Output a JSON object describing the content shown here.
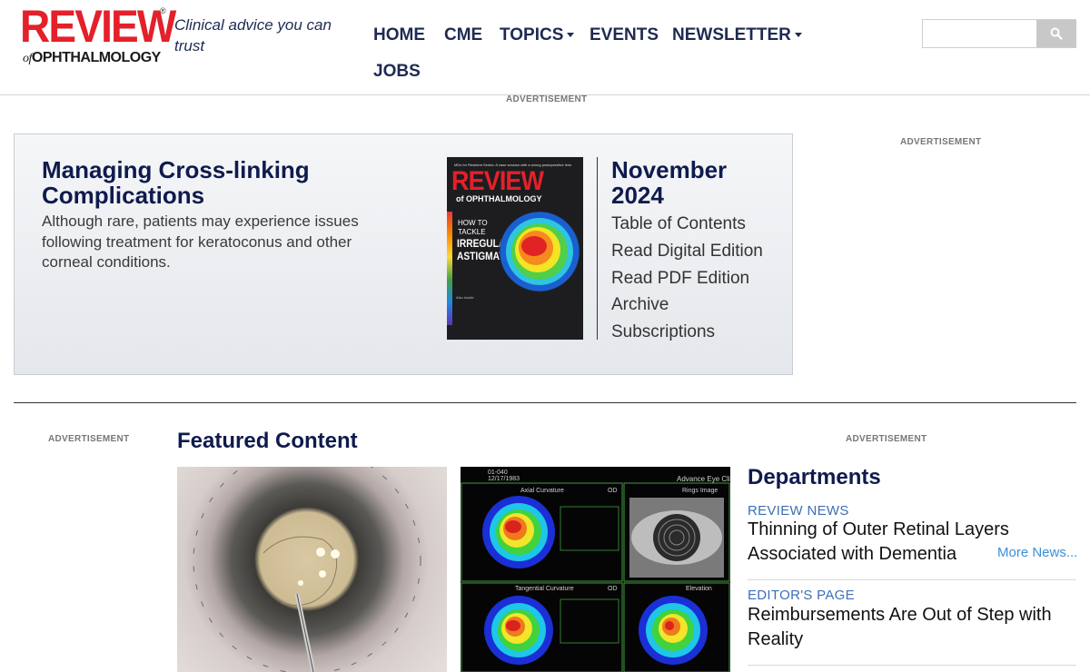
{
  "site": {
    "logo_main": "REVIEW",
    "logo_of": "of",
    "logo_sub": "OPHTHALMOLOGY",
    "logo_reg": "®",
    "tagline": "Clinical advice you can trust"
  },
  "nav": {
    "items": [
      {
        "label": "HOME"
      },
      {
        "label": "CME"
      },
      {
        "label": "TOPICS"
      },
      {
        "label": "EVENTS"
      },
      {
        "label": "NEWSLETTER"
      },
      {
        "label": "JOBS"
      }
    ]
  },
  "search": {
    "placeholder": "",
    "value": ""
  },
  "ads": {
    "top": "ADVERTISEMENT",
    "right": "ADVERTISEMENT",
    "left": "ADVERTISEMENT",
    "right2": "ADVERTISEMENT"
  },
  "hero": {
    "title": "Managing Cross-linking Complications",
    "description": "Although rare, patients may experience issues following treatment for keratoconus and other corneal conditions."
  },
  "cover": {
    "top_text": "MDs for Resident Series: A case session with a wrong postoperative lens",
    "logo": "REVIEW",
    "sub": "of OPHTHALMOLOGY",
    "how_to": "HOW TO TACKLE",
    "headline": "IRREGULAR ASTIGMATISM",
    "also": "Also Inside"
  },
  "issue": {
    "title": "November 2024",
    "links": [
      {
        "label": "Table of Contents"
      },
      {
        "label": "Read Digital Edition"
      },
      {
        "label": "Read PDF Edition"
      },
      {
        "label": "Archive"
      },
      {
        "label": "Subscriptions"
      }
    ]
  },
  "featured": {
    "title": "Featured Content"
  },
  "topo": {
    "clinic": "Advance Eye Clinic",
    "axial": "Axial Curvature",
    "rings": "Rings Image",
    "tangential": "Tangential Curvature",
    "elevation": "Elevation",
    "od": "OD",
    "id1": "01-040",
    "id2": "12/17/1983"
  },
  "departments": {
    "title": "Departments",
    "items": [
      {
        "category": "REVIEW NEWS",
        "headline": "Thinning of Outer Retinal Layers Associated with Dementia"
      },
      {
        "category": "EDITOR'S PAGE",
        "headline": "Reimbursements Are Out of Step with Reality"
      }
    ],
    "more": "More News..."
  },
  "colors": {
    "navy": "#0f1b4d",
    "brand_red": "#e4202a",
    "link_blue": "#3c6fb6"
  },
  "icons": {
    "search": "search-icon",
    "caret": "caret-down-icon"
  }
}
